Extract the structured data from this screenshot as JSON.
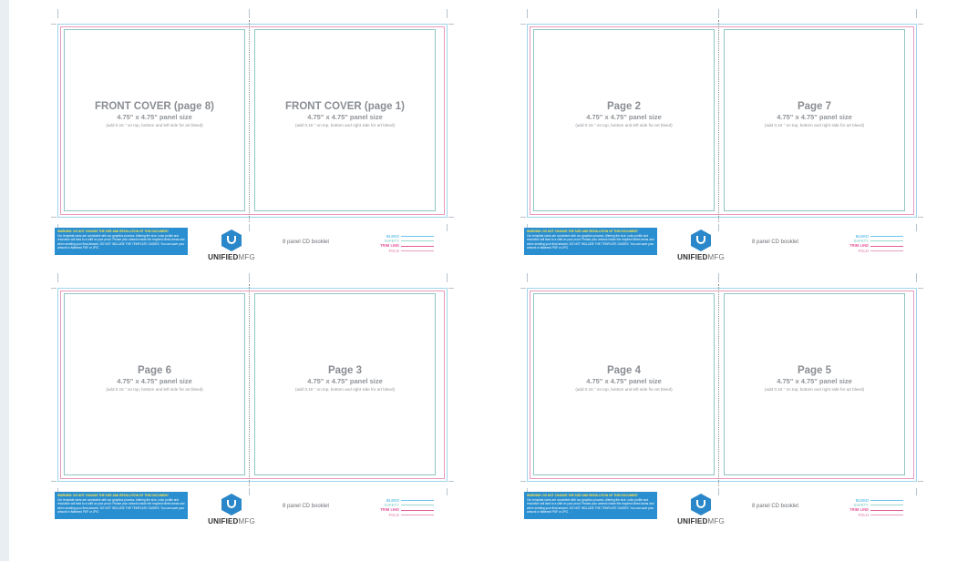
{
  "colors": {
    "bleed": "#9fd4ec",
    "trim": "#e79abf",
    "safety": "#8fc6c2",
    "warning_bg": "#2a8fd0",
    "logo": "#2a87c9"
  },
  "sheets": [
    {
      "left": {
        "title": "FRONT COVER (page 8)",
        "size": "4.75\" x 4.75\" panel size",
        "note": "(add 0.15 \" on top, bottom and left side for art bleed)"
      },
      "right": {
        "title": "FRONT COVER (page 1)",
        "size": "4.75\" x 4.75\" panel size",
        "note": "(add 0.15 \" on top, bottom and right side for art bleed)"
      }
    },
    {
      "left": {
        "title": "Page 2",
        "size": "4.75\" x 4.75\" panel size",
        "note": "(add 0.15 \" on top, bottom and left side for art bleed)"
      },
      "right": {
        "title": "Page 7",
        "size": "4.75\" x 4.75\" panel size",
        "note": "(add 0.15 \" on top, bottom and right side for art bleed)"
      }
    },
    {
      "left": {
        "title": "Page 6",
        "size": "4.75\" x 4.75\" panel size",
        "note": "(add 0.15 \" on top, bottom and left side for art bleed)"
      },
      "right": {
        "title": "Page 3",
        "size": "4.75\" x 4.75\" panel size",
        "note": "(add 0.15 \" on top, bottom and right side for art bleed)"
      }
    },
    {
      "left": {
        "title": "Page 4",
        "size": "4.75\" x 4.75\" panel size",
        "note": "(add 0.15 \" on top, bottom and left side for art bleed)"
      },
      "right": {
        "title": "Page 5",
        "size": "4.75\" x 4.75\" panel size",
        "note": "(add 0.15 \" on top, bottom and right side for art bleed)"
      }
    }
  ],
  "footer": {
    "warning_heading": "WARNING: DO NOT CHANGE THE SIZE AND RESOLUTION OF THIS DOCUMENT",
    "warning_body": "Our template sizes are consistent with our graphics process. Altering the size, color profile and resolution will lead to a shift on your proof. Please your artwork inside the required bleed areas and when sending your final artwork. DO NOT INCLUDE THE TEMPLATE GUIDES. You can save your artwork in flattened PDF or JPG.",
    "brand_bold": "UNIFIED",
    "brand_light": "MFG",
    "booklet_label": "8 panel CD booklet",
    "legend": [
      {
        "label": "BLEED",
        "color": "#6cc4ea"
      },
      {
        "label": "SAFETY",
        "color": "#9ad6d2"
      },
      {
        "label": "TRIM LINE",
        "color": "#e35a9b"
      },
      {
        "label": "FOLD",
        "color": "#e8a0c2"
      }
    ]
  }
}
